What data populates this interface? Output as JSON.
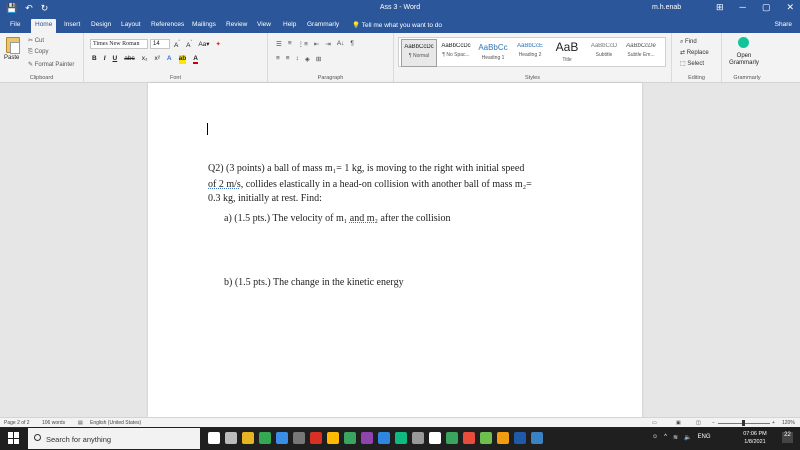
{
  "window": {
    "title": "Ass 3 - Word",
    "user": "m.h.enab",
    "controls": [
      "⊞",
      "─",
      "▢",
      "✕"
    ]
  },
  "qat": [
    "💾",
    "↶",
    "↻"
  ],
  "tabs": [
    "File",
    "Home",
    "Insert",
    "Design",
    "Layout",
    "References",
    "Mailings",
    "Review",
    "View",
    "Help",
    "Grammarly"
  ],
  "active_tab": "Home",
  "tell_me": "Tell me what you want to do",
  "share": "Share",
  "ribbon": {
    "clipboard": {
      "paste": "Paste",
      "cut": "Cut",
      "copy": "Copy",
      "format_painter": "Format Painter",
      "label": "Clipboard"
    },
    "font": {
      "name": "Times New Roman",
      "size": "14",
      "label": "Font",
      "bold": "B",
      "italic": "I",
      "underline": "U",
      "strike": "abc",
      "sub": "x₂",
      "sup": "x²"
    },
    "paragraph": {
      "label": "Paragraph"
    },
    "styles": {
      "label": "Styles",
      "items": [
        {
          "sample": "AaBbCcDc",
          "name": "¶ Normal"
        },
        {
          "sample": "AaBbCcDc",
          "name": "¶ No Spac..."
        },
        {
          "sample": "AaBbCc",
          "name": "Heading 1"
        },
        {
          "sample": "AaBbCcE",
          "name": "Heading 2"
        },
        {
          "sample": "AaB",
          "name": "Title"
        },
        {
          "sample": "AaBbCcD",
          "name": "Subtitle"
        },
        {
          "sample": "AaBbCcDe",
          "name": "Subtle Em..."
        }
      ]
    },
    "editing": {
      "find": "Find",
      "replace": "Replace",
      "select": "Select",
      "label": "Editing"
    },
    "grammarly": {
      "open": "Open Grammarly",
      "label": "Grammarly"
    }
  },
  "document": {
    "q2_line1": "Q2) (3 points) a ball of mass m₁= 1 kg, is moving to the right with initial speed",
    "q2_line2a": "of 2 m/s",
    "q2_line2b": ", collides elastically in  a head-on collision with another ball of mass m₂=",
    "q2_line3": "0.3 kg, initially at rest. Find:",
    "part_a_a": "a)  (1.5 pts.) The velocity of m₁ ",
    "part_a_b": "and  m₂",
    "part_a_c": " after the collision",
    "part_b": "b)  (1.5 pts.) The change in the kinetic energy"
  },
  "status": {
    "page": "Page 2 of 2",
    "words": "106 words",
    "language": "English (United States)",
    "zoom": "120%"
  },
  "taskbar": {
    "search": "Search for anything",
    "lang": "ENG",
    "time": "07:06 PM",
    "date": "1/8/2021",
    "notif": "22",
    "app_colors": [
      "#ffffff",
      "#bbbbbb",
      "#e6b422",
      "#34a853",
      "#3a8ee6",
      "#777777",
      "#d93025",
      "#ffb900",
      "#3aa55f",
      "#8e44ad",
      "#2e86de",
      "#10b981",
      "#999999",
      "#ffffff",
      "#3aa55f",
      "#e74c3c",
      "#6dc04b",
      "#f39c12",
      "#1e5aa8",
      "#3b82c4"
    ]
  }
}
